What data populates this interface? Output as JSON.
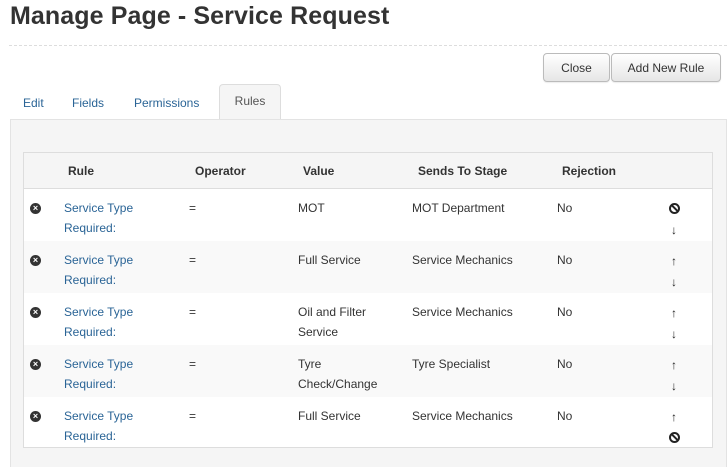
{
  "page": {
    "title": "Manage Page - Service Request"
  },
  "toolbar": {
    "close_label": "Close",
    "add_rule_label": "Add New Rule"
  },
  "tabs": [
    {
      "label": "Edit",
      "active": false
    },
    {
      "label": "Fields",
      "active": false
    },
    {
      "label": "Permissions",
      "active": false
    },
    {
      "label": "Rules",
      "active": true
    }
  ],
  "table": {
    "headers": [
      "Rule",
      "Operator",
      "Value",
      "Sends To Stage",
      "Rejection"
    ],
    "rows": [
      {
        "rule": "Service Type Required:",
        "operator": "=",
        "value": "MOT",
        "stage": "MOT Department",
        "rejection": "No",
        "actions": [
          "ban-icon",
          "arrow-down-icon"
        ]
      },
      {
        "rule": "Service Type Required:",
        "operator": "=",
        "value": "Full Service",
        "stage": "Service Mechanics",
        "rejection": "No",
        "actions": [
          "arrow-up-icon",
          "arrow-down-icon"
        ]
      },
      {
        "rule": "Service Type Required:",
        "operator": "=",
        "value": "Oil and Filter Service",
        "stage": "Service Mechanics",
        "rejection": "No",
        "actions": [
          "arrow-up-icon",
          "arrow-down-icon"
        ]
      },
      {
        "rule": "Service Type Required:",
        "operator": "=",
        "value": "Tyre Check/Change",
        "stage": "Tyre Specialist",
        "rejection": "No",
        "actions": [
          "arrow-up-icon",
          "arrow-down-icon"
        ]
      },
      {
        "rule": "Service Type Required:",
        "operator": "=",
        "value": "Full Service",
        "stage": "Service Mechanics",
        "rejection": "No",
        "actions": [
          "arrow-up-icon",
          "ban-icon"
        ]
      }
    ]
  },
  "colors": {
    "link": "#2a6496",
    "panel": "#f5f5f5",
    "border": "#dddddd"
  }
}
